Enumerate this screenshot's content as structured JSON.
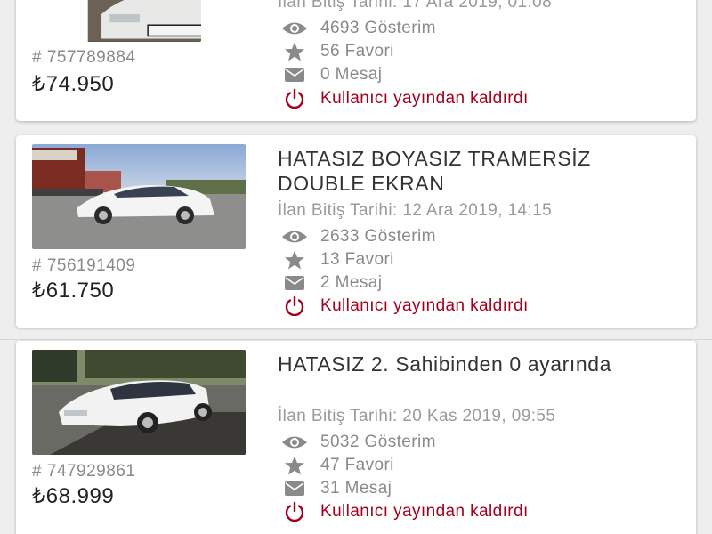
{
  "colors": {
    "accent_red": "#a3001e",
    "muted_text": "#8a8a8a",
    "price_text": "#222222",
    "background": "#eeeeee"
  },
  "icons": {
    "views": "eye-icon",
    "favorites": "star-icon",
    "messages": "envelope-icon",
    "status": "power-icon"
  },
  "listings": [
    {
      "id": "# 757789884",
      "price": "₺74.950",
      "title": "",
      "end_date": "İlan Bitiş Tarihi: 17 Ara 2019, 01:08",
      "views": "4693 Gösterim",
      "favorites": "56 Favori",
      "messages": "0 Mesaj",
      "status": "Kullanıcı yayından kaldırdı"
    },
    {
      "id": "# 756191409",
      "price": "₺61.750",
      "title": "HATASIZ BOYASIZ TRAMERSİZ DOUBLE EKRAN",
      "end_date": "İlan Bitiş Tarihi: 12 Ara 2019, 14:15",
      "views": "2633 Gösterim",
      "favorites": "13 Favori",
      "messages": "2 Mesaj",
      "status": "Kullanıcı yayından kaldırdı"
    },
    {
      "id": "# 747929861",
      "price": "₺68.999",
      "title": "HATASIZ 2. Sahibinden 0 ayarında",
      "end_date": "İlan Bitiş Tarihi: 20 Kas 2019, 09:55",
      "views": "5032 Gösterim",
      "favorites": "47 Favori",
      "messages": "31 Mesaj",
      "status": "Kullanıcı yayından kaldırdı"
    }
  ]
}
